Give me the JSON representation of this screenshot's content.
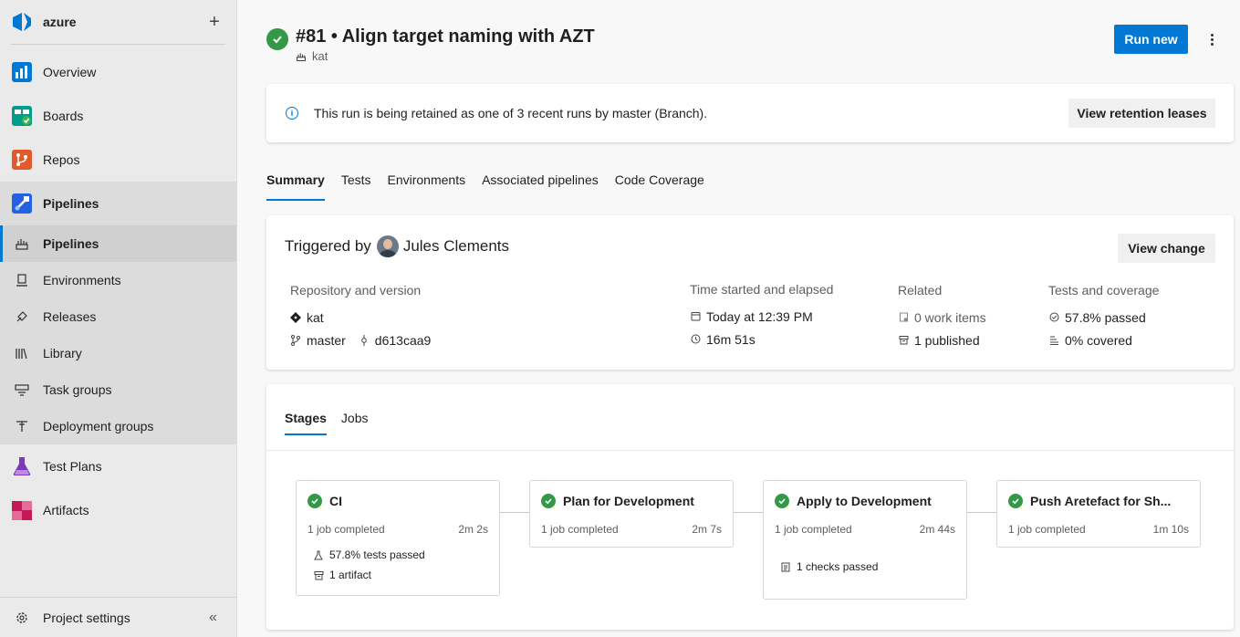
{
  "colors": {
    "accent": "#0078d4",
    "success": "#339947",
    "sidebar_bg": "#eaeaea",
    "selected_bg": "#d0d0d0"
  },
  "sidebar": {
    "org_name": "azure",
    "add_label": "+",
    "items": [
      {
        "label": "Overview",
        "icon": "overview-icon"
      },
      {
        "label": "Boards",
        "icon": "boards-icon"
      },
      {
        "label": "Repos",
        "icon": "repos-icon"
      },
      {
        "label": "Pipelines",
        "icon": "pipelines-icon"
      }
    ],
    "pipelines_sub": [
      {
        "label": "Pipelines",
        "icon": "pipelines-sub-icon"
      },
      {
        "label": "Environments",
        "icon": "environments-icon"
      },
      {
        "label": "Releases",
        "icon": "releases-icon"
      },
      {
        "label": "Library",
        "icon": "library-icon"
      },
      {
        "label": "Task groups",
        "icon": "task-groups-icon"
      },
      {
        "label": "Deployment groups",
        "icon": "deployment-groups-icon"
      }
    ],
    "more_items": [
      {
        "label": "Test Plans",
        "icon": "test-plans-icon"
      },
      {
        "label": "Artifacts",
        "icon": "artifacts-icon"
      }
    ],
    "settings_label": "Project settings",
    "collapse_label": "«"
  },
  "header": {
    "title": "#81 • Align target naming with AZT",
    "pipeline": "kat",
    "run_new_label": "Run new"
  },
  "banner": {
    "info_glyph": "i",
    "message": "This run is being retained as one of 3 recent runs by master (Branch).",
    "button_label": "View retention leases"
  },
  "tabs": [
    "Summary",
    "Tests",
    "Environments",
    "Associated pipelines",
    "Code Coverage"
  ],
  "summary": {
    "triggered_by_label": "Triggered by",
    "user": "Jules Clements",
    "view_change_label": "View change",
    "repo_header": "Repository and version",
    "repo": "kat",
    "branch": "master",
    "commit": "d613caa9",
    "time_header": "Time started and elapsed",
    "started": "Today at 12:39 PM",
    "elapsed": "16m 51s",
    "related_header": "Related",
    "work_items": "0 work items",
    "published": "1 published",
    "tests_header": "Tests and coverage",
    "tests_passed": "57.8% passed",
    "coverage": "0% covered"
  },
  "stage_tabs": [
    "Stages",
    "Jobs"
  ],
  "stages": [
    {
      "name": "CI",
      "jobs": "1 job completed",
      "duration": "2m 2s",
      "extras": [
        "57.8% tests passed",
        "1 artifact"
      ]
    },
    {
      "name": "Plan for Development",
      "jobs": "1 job completed",
      "duration": "2m 7s",
      "extras": []
    },
    {
      "name": "Apply to Development",
      "jobs": "1 job completed",
      "duration": "2m 44s",
      "extras": [
        "1 checks passed"
      ]
    },
    {
      "name": "Push Aretefact for Sh...",
      "jobs": "1 job completed",
      "duration": "1m 10s",
      "extras": []
    }
  ]
}
